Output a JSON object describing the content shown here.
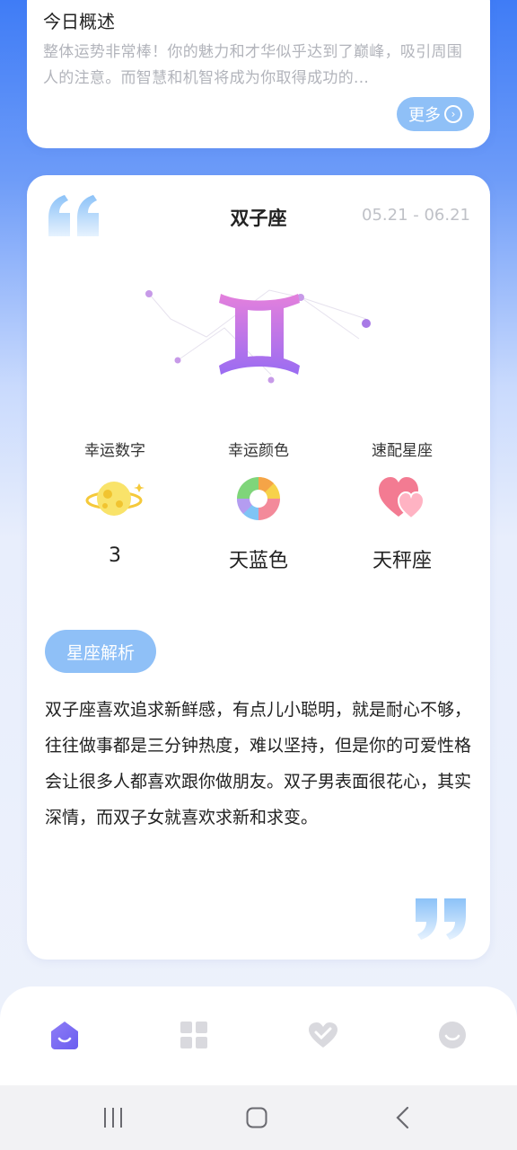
{
  "overview": {
    "title": "今日概述",
    "summary": "整体运势非常棒！你的魅力和才华似乎达到了巅峰，吸引周围人的注意。而智慧和机智将成为你取得成功的...",
    "more_label": "更多"
  },
  "sign": {
    "name": "双子座",
    "date_range": "05.21 - 06.21",
    "symbol": "Ⅱ"
  },
  "stats": [
    {
      "label": "幸运数字",
      "value": "3",
      "icon": "planet-icon"
    },
    {
      "label": "幸运颜色",
      "value": "天蓝色",
      "icon": "color-wheel-icon"
    },
    {
      "label": "速配星座",
      "value": "天秤座",
      "icon": "hearts-icon"
    }
  ],
  "analysis": {
    "button_label": "星座解析",
    "text": "双子座喜欢追求新鲜感，有点儿小聪明，就是耐心不够，往往做事都是三分钟热度，难以坚持，但是你的可爱性格会让很多人都喜欢跟你做朋友。双子男表面很花心，其实深情，而双子女就喜欢求新和求变。"
  },
  "bottom_nav": [
    {
      "name": "home",
      "icon": "home-icon",
      "active": true
    },
    {
      "name": "grid",
      "icon": "grid-icon",
      "active": false
    },
    {
      "name": "match",
      "icon": "heart-icon",
      "active": false
    },
    {
      "name": "profile",
      "icon": "smiley-icon",
      "active": false
    }
  ],
  "colors": {
    "accent": "#8fc0f7",
    "nav_active": "#7a6ef2",
    "nav_inactive": "#d9d9de",
    "symbol_start": "#e07ce0",
    "symbol_end": "#9b6cf0"
  }
}
